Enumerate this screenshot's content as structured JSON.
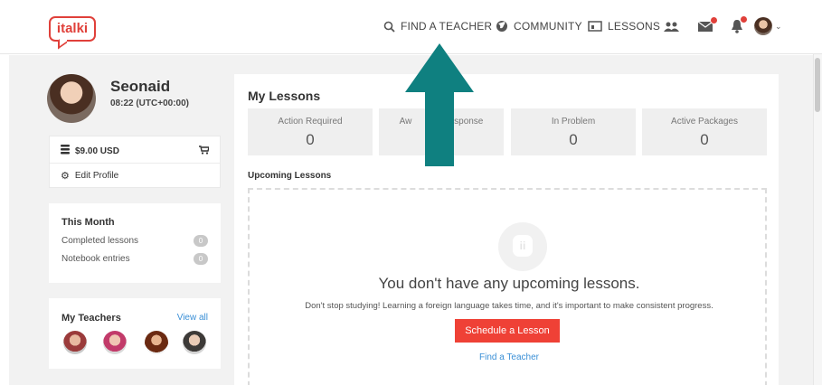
{
  "header": {
    "logo": "italki",
    "nav": {
      "find_teacher": "FIND A TEACHER",
      "community": "COMMUNITY",
      "lessons": "LESSONS"
    },
    "badges_color": "#e0403a"
  },
  "profile": {
    "name": "Seonaid",
    "time": "08:22 (UTC+00:00)"
  },
  "wallet": {
    "balance": "$9.00 USD",
    "edit_profile": "Edit Profile"
  },
  "this_month": {
    "title": "This Month",
    "rows": [
      {
        "label": "Completed lessons",
        "count": "0"
      },
      {
        "label": "Notebook entries",
        "count": "0"
      }
    ]
  },
  "teachers": {
    "title": "My Teachers",
    "view_all": "View all"
  },
  "lessons": {
    "title": "My Lessons",
    "stats": [
      {
        "label": "Action Required",
        "value": "0"
      },
      {
        "label": "Aw",
        "label_tail": "Response",
        "value": "0"
      },
      {
        "label": "In Problem",
        "value": "0"
      },
      {
        "label": "Active Packages",
        "value": "0"
      }
    ],
    "upcoming_heading": "Upcoming Lessons",
    "empty_title": "You don't have any upcoming lessons.",
    "empty_sub": "Don't stop studying! Learning a foreign language takes time, and it's important to make consistent progress.",
    "schedule_button": "Schedule a Lesson",
    "find_teacher_link": "Find a Teacher",
    "empty_icon_letter": "ii"
  },
  "colors": {
    "accent": "#ef4136",
    "link": "#3a8fd6",
    "arrow": "#0f8080"
  }
}
